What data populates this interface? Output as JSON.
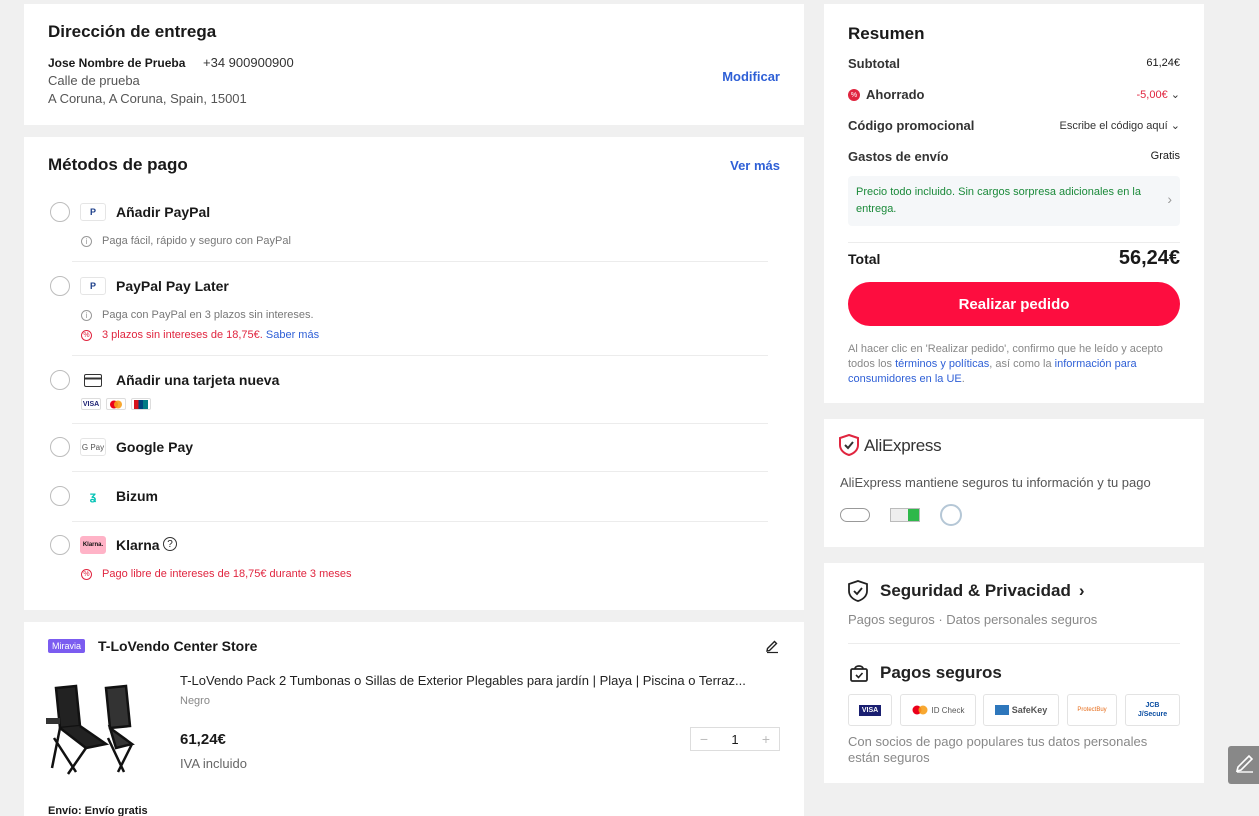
{
  "address": {
    "title": "Dirección de entrega",
    "name": "Jose Nombre de Prueba",
    "phone": "+34 900900900",
    "street": "Calle de prueba",
    "city": "A Coruna, A Coruna, Spain, 15001",
    "edit_label": "Modificar"
  },
  "payment": {
    "title": "Métodos de pago",
    "see_more": "Ver más",
    "methods": [
      {
        "label": "Añadir PayPal",
        "icon": "paypal-icon",
        "note": "Paga fácil, rápido y seguro con PayPal"
      },
      {
        "label": "PayPal Pay Later",
        "icon": "paypal-icon",
        "note": "Paga con PayPal en 3 plazos sin intereses.",
        "promo": "3 plazos sin intereses de 18,75€.",
        "promo_link": "Saber más"
      },
      {
        "label": "Añadir una tarjeta nueva",
        "icon": "card-icon",
        "cards": [
          "VISA",
          "MC",
          "UP"
        ]
      },
      {
        "label": "Google Pay",
        "icon": "google-pay-icon",
        "icon_text": "G Pay"
      },
      {
        "label": "Bizum",
        "icon": "bizum-icon"
      },
      {
        "label": "Klarna",
        "icon": "klarna-icon",
        "icon_text": "Klarna.",
        "promo": "Pago libre de intereses de 18,75€ durante 3 meses"
      }
    ]
  },
  "store": {
    "badge": "Miravia",
    "name": "T-LoVendo Center Store",
    "product_title": "T-LoVendo Pack 2 Tumbonas o Sillas de Exterior Plegables para jardín | Playa | Piscina o Terraz...",
    "variant": "Negro",
    "price": "61,24€",
    "tax_note": "IVA incluido",
    "quantity": "1",
    "shipping": "Envío: Envío gratis"
  },
  "summary": {
    "title": "Resumen",
    "subtotal_label": "Subtotal",
    "subtotal_value": "61,24€",
    "saved_label": "Ahorrado",
    "saved_value": "-5,00€",
    "promo_label": "Código promocional",
    "promo_value": "Escribe el código aquí",
    "shipping_label": "Gastos de envío",
    "shipping_value": "Gratis",
    "notice": "Precio todo incluido. Sin cargos sorpresa adicionales en la entrega.",
    "total_label": "Total",
    "total_value": "56,24€",
    "order_button": "Realizar pedido",
    "legal_1": "Al hacer clic en 'Realizar pedido', confirmo que he leído y acepto todos los ",
    "legal_link1": "términos y políticas",
    "legal_2": ", así como la ",
    "legal_link2": "información para consumidores en la UE",
    "legal_3": "."
  },
  "aliexpress": {
    "brand": "AliExpress",
    "text": "AliExpress mantiene seguros tu información y tu pago"
  },
  "security": {
    "title": "Seguridad & Privacidad",
    "subtitle": "Pagos seguros · Datos personales seguros",
    "payments_title": "Pagos seguros",
    "badges": [
      "VISA",
      "ID Check",
      "SafeKey",
      "ProtectBuy",
      "JCB J/Secure"
    ],
    "footer": "Con socios de pago populares tus datos personales están seguros"
  },
  "colors": {
    "accent_red": "#fd0d3f",
    "link_blue": "#2e5fd6",
    "notice_green": "#1b8a3a"
  }
}
